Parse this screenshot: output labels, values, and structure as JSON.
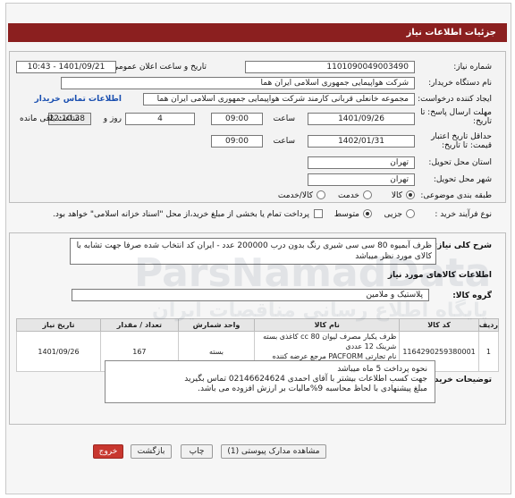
{
  "header": {
    "title": "جزئیات اطلاعات نیاز"
  },
  "form": {
    "need_number_label": "شماره نیاز:",
    "need_number": "1101090049003490",
    "announce_label": "تاریخ و ساعت اعلان عمومی:",
    "announce_value": "1401/09/21 - 10:43",
    "buyer_org_label": "نام دستگاه خریدار:",
    "buyer_org": "شرکت هواپیمایی جمهوری اسلامی ایران هما",
    "creator_label": "ایجاد کننده درخواست:",
    "creator": "مجموعه خانعلی قربانی کارمند شرکت هواپیمایی جمهوری اسلامی ایران هما",
    "contact_link": "اطلاعات تماس خریدار",
    "deadline_label": "مهلت ارسال پاسخ: تا تاریخ:",
    "deadline_date": "1401/09/26",
    "time_label": "ساعت",
    "deadline_time": "09:00",
    "day_and": "روز و",
    "days": "4",
    "remaining_time": "22:10:38",
    "remaining_label": "ساعت باقی مانده",
    "validity_label": "حداقل تاریخ اعتبار قیمت: تا تاریخ:",
    "validity_date": "1402/01/31",
    "validity_time": "09:00",
    "province_label": "استان محل تحویل:",
    "province": "تهران",
    "city_label": "شهر محل تحویل:",
    "city": "تهران",
    "category_label": "طبقه بندی موضوعی:",
    "category_options": [
      "کالا",
      "خدمت",
      "کالا/خدمت"
    ],
    "process_label": "نوع فرآیند خرید :",
    "process_options": [
      "جزیی",
      "متوسط"
    ],
    "payment_note": "پرداخت تمام یا بخشی از مبلغ خرید،از محل \"اسناد خزانه اسلامی\" خواهد بود."
  },
  "detail": {
    "summary_label": "شرح کلی نیاز:",
    "summary": "ظرف آبمیوه 80 سی سی شیری رنگ بدون درب 200000 عدد  - ایران کد انتخاب شده صرفا جهت تشابه با کالای مورد نظر میباشد",
    "goods_info_title": "اطلاعات کالاهای مورد نیاز",
    "group_label": "گروه کالا:",
    "group_value": "پلاستیک و ملامین",
    "table_headers": [
      "ردیف",
      "کد کالا",
      "نام کالا",
      "واحد شمارش",
      "تعداد / مقدار",
      "تاریخ نیاز"
    ],
    "rows": [
      {
        "row": "1",
        "code": "1164290259380001",
        "name_line1": "ظرف یکبار مصرف لیوان cc 80 کاغذی بسته شرینک 12 عددی",
        "name_line2": "نام تجارتی PACFORM مرجع عرضه کننده حمیدرضا خداداد",
        "unit": "بسته",
        "qty": "167",
        "date": "1401/09/26"
      }
    ],
    "buyer_notes_label": "توضیحات خریدار:",
    "buyer_notes": [
      "نحوه پرداخت 5 ماه  میباشد",
      "جهت کسب اطلاعات بیشتر با آقای  احمدی  02146624624 تماس بگیرید",
      "مبلغ پیشنهادی با لحاظ محاسبه 9%مالیات بر ارزش افزوده می باشد."
    ]
  },
  "buttons": {
    "attachments": "مشاهده مدارک پیوستی (1)",
    "print": "چاپ",
    "back": "بازگشت",
    "exit": "خروج"
  },
  "watermark": {
    "brand": "ParsNamadData",
    "fa": "پایگاه اطلاع رسانی مناقصات ایران"
  }
}
